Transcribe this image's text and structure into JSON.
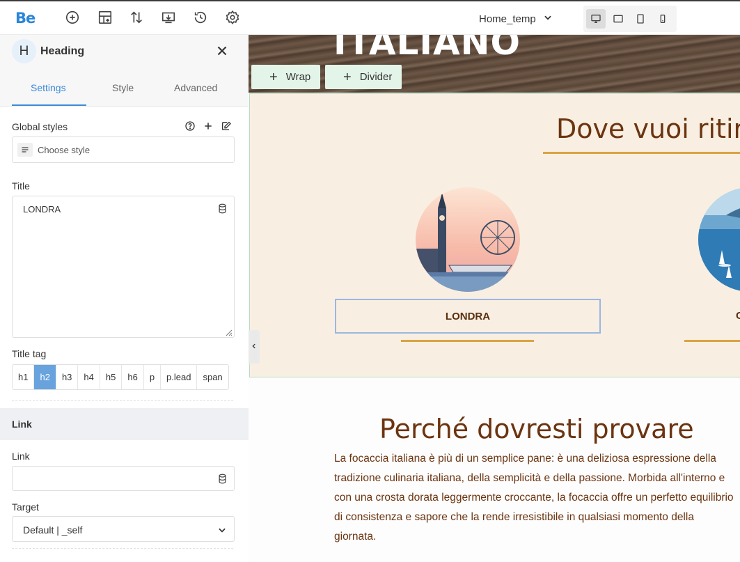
{
  "app": {
    "logo": "Be"
  },
  "toolbar": {
    "tools": [
      "add-icon",
      "layout-icon",
      "sort-icon",
      "import-icon",
      "history-icon",
      "gear-icon"
    ],
    "template_name": "Home_temp",
    "devices": [
      "desktop-icon",
      "tablet-landscape-icon",
      "tablet-portrait-icon",
      "mobile-icon"
    ],
    "active_device": "desktop-icon"
  },
  "panel": {
    "badge": "H",
    "title": "Heading",
    "tabs": [
      {
        "label": "Settings",
        "active": true
      },
      {
        "label": "Style",
        "active": false
      },
      {
        "label": "Advanced",
        "active": false
      }
    ],
    "global_styles_label": "Global styles",
    "choose_style_placeholder": "Choose style",
    "title_label": "Title",
    "title_value": "LONDRA",
    "title_tag_label": "Title tag",
    "title_tags": [
      "h1",
      "h2",
      "h3",
      "h4",
      "h5",
      "h6",
      "p",
      "p.lead",
      "span"
    ],
    "active_tag": "h2",
    "link_section": "Link",
    "link_label": "Link",
    "link_value": "",
    "target_label": "Target",
    "target_value": "Default | _self"
  },
  "canvas": {
    "hero_title": "ITALIANO",
    "chips": [
      {
        "icon": "+",
        "label": "Wrap"
      },
      {
        "icon": "+",
        "label": "Divider"
      }
    ],
    "section_title": "Dove vuoi ritir",
    "city_selected": "LONDRA",
    "city_cut": "C",
    "perche_title": "Perché dovresti provare",
    "paragraph": "La focaccia italiana è più di un semplice pane: è una deliziosa espressione della tradizione culinaria italiana, della semplicità e della passione. Morbida all'interno e con una crosta dorata leggermente croccante, la focaccia offre un perfetto equilibrio di consistenza e sapore che la rende irresistibile in qualsiasi momento della giornata."
  },
  "colors": {
    "accent": "#3b8ad9",
    "brown_text": "#6b3410",
    "gold": "#d9a441",
    "cream": "#f8efe2",
    "chip_green": "#e3f4e9"
  }
}
